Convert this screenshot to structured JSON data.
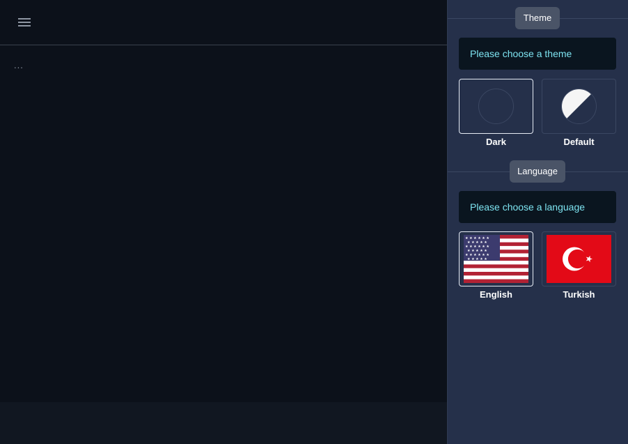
{
  "main": {
    "menu_icon": "hamburger-menu-icon",
    "content_text": "...",
    "colors": {
      "background": "#0c111a",
      "footer": "#111721"
    }
  },
  "panel": {
    "colors": {
      "background": "#25304a",
      "pill": "#4a5467",
      "prompt_bg": "#0a151f",
      "prompt_text": "#7de3f0"
    },
    "theme": {
      "header": "Theme",
      "prompt": "Please choose a theme",
      "options": [
        {
          "label": "Dark",
          "icon": "dark-theme-circle-icon",
          "selected": true
        },
        {
          "label": "Default",
          "icon": "default-theme-half-circle-icon",
          "selected": false
        }
      ]
    },
    "language": {
      "header": "Language",
      "prompt": "Please choose a language",
      "options": [
        {
          "label": "English",
          "icon": "us-flag-icon",
          "selected": true
        },
        {
          "label": "Turkish",
          "icon": "turkey-flag-icon",
          "selected": false
        }
      ]
    }
  }
}
